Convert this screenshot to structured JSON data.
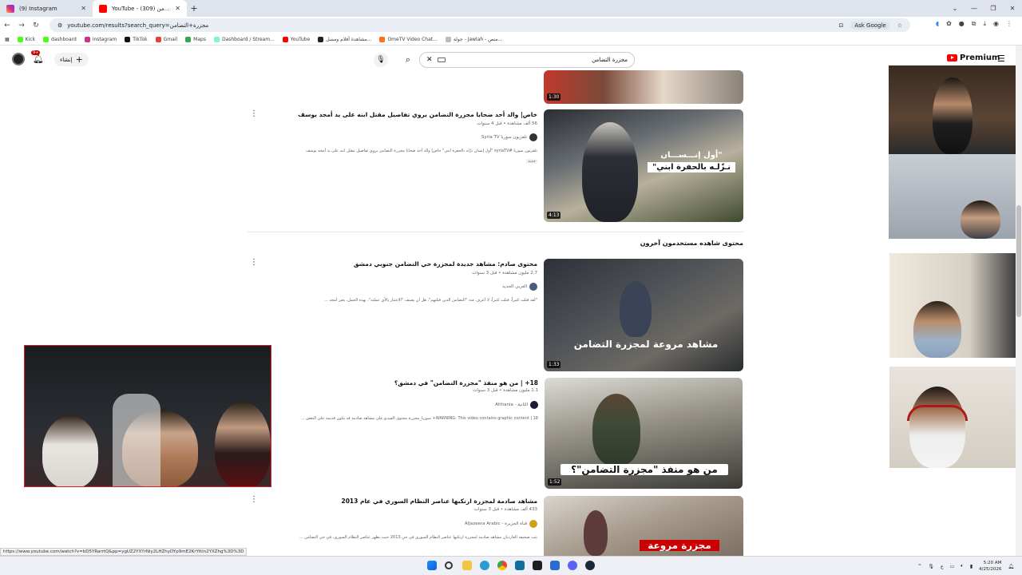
{
  "browser": {
    "tabs": [
      {
        "title": "(9) Instagram",
        "active": false
      },
      {
        "title": "YouTube - مجزرة التضامن (309)",
        "active": true
      }
    ],
    "url": "youtube.com/results?search_query=مجزرة+التضامن",
    "ask_google": "Ask Google",
    "status_url": "https://www.youtube.com/watch?v=bD5YRarrtQ&pp=ygUZ2YXYrNiy2LHZhyDYp9mE2KrYttin2YXZhg%3D%3D"
  },
  "bookmarks": [
    "Kick",
    "dashboard",
    "instagram",
    "TikTok",
    "Gmail",
    "Maps",
    "Dashboard / Stream...",
    "YouTube",
    "مشاهدة أفلام ومسل...",
    "OmeTV Video Chat...",
    "جولة - Jawlah - منص..."
  ],
  "youtube": {
    "create_label": "إنشاء",
    "notif_count": "9+",
    "search_query": "مجزرة التضامن",
    "premium_label": "Premium"
  },
  "results": [
    {
      "title": "خاص| والد أحد ضحايا مجزرة التضامن يروي تفاصيل مقتل ابنه على يد أمجد يوسف",
      "meta": "56 ألف مشاهدة • قبل 4 سنوات",
      "channel": "تلفزيون سوريا Syria TV",
      "desc": "تلفزيون سوريا #syriaTV \"أول إنسان نزّله بالحفرة ابني\" خاص| والد أحد ضحايا مجزرة التضامن يروي تفاصيل مقتل ابنه على يد أمجد يوسف",
      "badge": "جديد",
      "duration": "4:13",
      "overlay": [
        "\"أول إنـــســـان",
        "نـزّلـه بالحفرة ابني\""
      ]
    },
    {
      "title": "محتوى صادم: مشاهد جديدة لمجزرة حي التضامن جنوبي دمشق",
      "meta": "2.7 مليون مشاهدة • قبل 3 سنوات",
      "channel": "العربي الجديد",
      "desc": "\"لقد قتلت كثيراً، قتلت كثيراً، لا أعرف عدد \"التضامن الذين قتلتهم\"، هل أن يصنف \"الاعتبار بالأي عملته\"، بهذه الجمل، يعبر أمجد ...",
      "duration": "1:33",
      "overlay": [
        "مشاهد مروعة لمجزرة التضامن"
      ]
    },
    {
      "title": "18+ | من هو منفذ \"مجزرة التضامن\" في دمشق؟",
      "meta": "1.1 مليون مشاهدة • قبل 3 سنوات",
      "channel": "الثانية - Althania",
      "desc": "WARNING: This video contains graphic content | 18+ سوريا_مجزرة محتوى الفيديو على مشاهد صادمة قد تكون قديمة على البعض ...",
      "duration": "1:52",
      "overlay": [
        "من هو منفذ \"مجزرة التضامن\"؟"
      ]
    },
    {
      "title": "مشاهد صادمة لمجزرة ارتكبها عناصر النظام السوري في عام 2013",
      "meta": "433 ألف مشاهدة • قبل 3 سنوات",
      "channel": "قناة الجزيرة - AlJazeera Arabic",
      "desc": "بثت صحيفة الغارديان مشاهد صادمة لمجزرة ارتكبها عناصر النظام السوري في حي 2013 حيث تظهر عناصر النظام السوري، في حي التضامن ...",
      "overlay": [
        "مجزرة مروعة"
      ]
    }
  ],
  "top_partial": {
    "duration": "1:30"
  },
  "section_heading": "محتوى شاهده مستخدمون آخرون",
  "taskbar": {
    "time": "5:20 AM",
    "date": "4/25/2026",
    "lang": "ع"
  }
}
